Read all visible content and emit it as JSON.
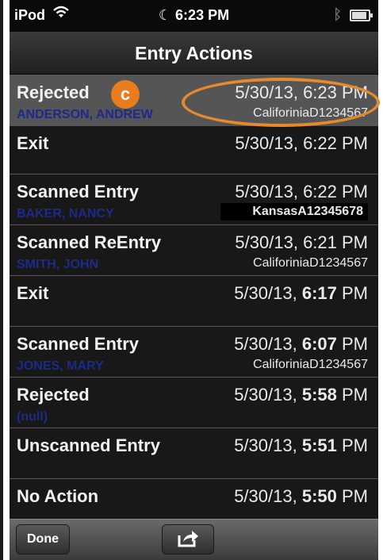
{
  "status_bar": {
    "carrier": "iPod",
    "time": "6:23 PM",
    "wifi_icon": "wifi-icon",
    "bluetooth_icon": "bluetooth-icon",
    "battery_level": 0.9
  },
  "nav": {
    "title": "Entry Actions"
  },
  "badge_letter": "c",
  "rows": [
    {
      "action": "Rejected",
      "person": "ANDERSON, ANDREW",
      "date": "5/30/13,",
      "time": "6:23 PM",
      "license": "CaliforiniaD1234567"
    },
    {
      "action": "Exit",
      "date": "5/30/13,",
      "time": "6:22 PM"
    },
    {
      "action": "Scanned Entry",
      "person": "BAKER, NANCY",
      "date": "5/30/13,",
      "time": "6:22 PM",
      "license": "KansasA12345678"
    },
    {
      "action": "Scanned ReEntry",
      "person": "SMITH, JOHN",
      "date": "5/30/13,",
      "time": "6:21 PM",
      "license": "CaliforiniaD1234567"
    },
    {
      "action": "Exit",
      "date": "5/30/13,",
      "time": "6:17",
      "time_suffix": "PM"
    },
    {
      "action": "Scanned Entry",
      "person": "JONES, MARY",
      "date": "5/30/13,",
      "time": "6:07",
      "time_suffix": "PM",
      "license": "CaliforiniaD1234567"
    },
    {
      "action": "Rejected",
      "person": "(null)",
      "date": "5/30/13,",
      "time": "5:58",
      "time_suffix": "PM"
    },
    {
      "action": "Unscanned Entry",
      "date": "5/30/13,",
      "time": "5:51",
      "time_suffix": "PM"
    },
    {
      "action": "No Action",
      "date": "5/30/13,",
      "time": "5:50",
      "time_suffix": "PM"
    }
  ],
  "toolbar": {
    "done_label": "Done",
    "share_icon": "share-icon"
  },
  "colors": {
    "accent_orange": "#e87c1e",
    "name_blue": "#1c2a8c"
  }
}
